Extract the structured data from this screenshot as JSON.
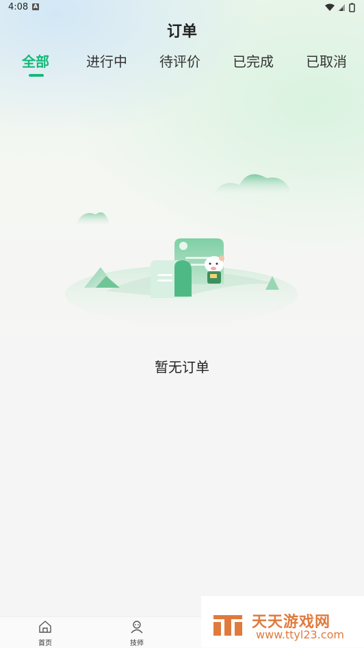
{
  "status_bar": {
    "time": "4:08",
    "notification_badge": "A"
  },
  "header": {
    "title": "订单"
  },
  "tabs": [
    {
      "label": "全部",
      "active": true
    },
    {
      "label": "进行中",
      "active": false
    },
    {
      "label": "待评价",
      "active": false
    },
    {
      "label": "已完成",
      "active": false
    },
    {
      "label": "已取消",
      "active": false
    }
  ],
  "empty_state": {
    "message": "暂无订单",
    "illustration": "empty-orders-illustration"
  },
  "bottom_nav": [
    {
      "label": "首页",
      "icon": "home-icon"
    },
    {
      "label": "技师",
      "icon": "technician-icon"
    }
  ],
  "watermark": {
    "name": "天天游戏网",
    "url": "www.ttyl23.com"
  },
  "colors": {
    "accent": "#16b878",
    "watermark": "#e07a3c"
  }
}
